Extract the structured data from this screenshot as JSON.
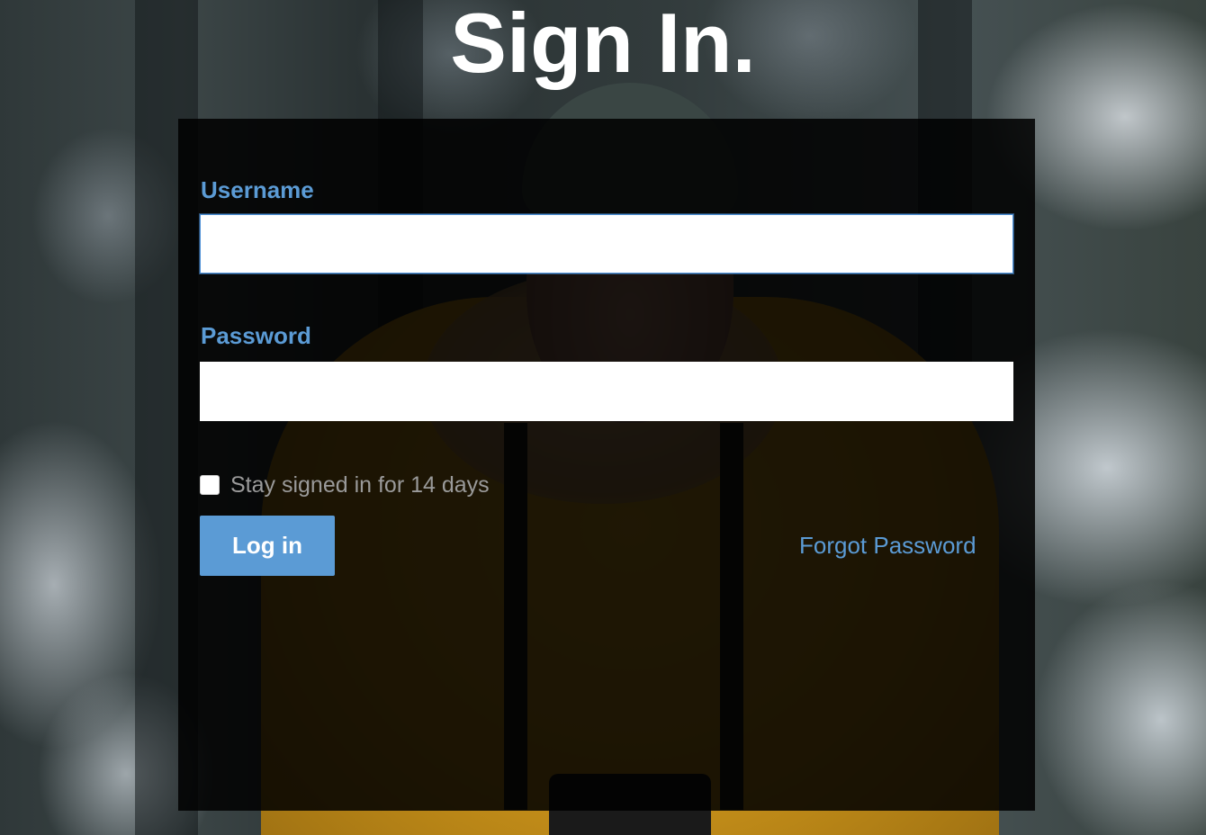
{
  "page": {
    "title": "Sign In."
  },
  "form": {
    "username_label": "Username",
    "username_value": "",
    "password_label": "Password",
    "password_value": "",
    "remember_checked": false,
    "remember_label": "Stay signed in for 14 days",
    "login_button_label": "Log in",
    "forgot_password_label": "Forgot Password"
  },
  "colors": {
    "accent": "#5b9bd5",
    "panel_background": "rgba(0,0,0,0.86)",
    "title_text": "#ffffff",
    "muted_text": "#9a9a9a"
  }
}
